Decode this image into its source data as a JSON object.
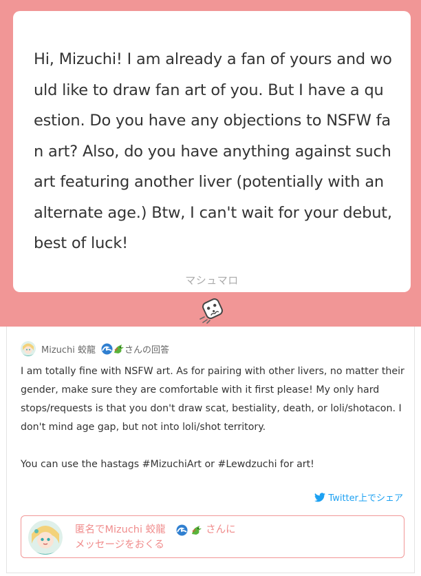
{
  "question": {
    "text": "Hi, Mizuchi!  I am already a fan of yours and would like to draw fan art of you. But I have a question. Do you have any objections to NSFW fan art? Also, do you have anything against such art featuring another liver  (potentially with an alternate age.) Btw, I can't wait for your debut, best of luck!",
    "service_label": "マシュマロ"
  },
  "answer": {
    "author_name": "Mizuchi 蛟龍",
    "header_suffix": "さんの回答",
    "paragraphs": [
      "I am totally fine with NSFW art. As for pairing with other livers, no matter their gender, make sure they are comfortable with it first please! My only hard stops/requests is that you don't draw scat, bestiality, death, or loli/shotacon. I don't mind age gap, but not into loli/shot territory.",
      "You can use the hastags #MizuchiArt or #Lewdzuchi for art!"
    ],
    "share_label": "Twitter上でシェア"
  },
  "send_box": {
    "line1_prefix": "匿名でMizuchi 蛟龍",
    "line1_suffix": "さんに",
    "line2": "メッセージをおくる"
  },
  "colors": {
    "accent": "#f19696",
    "text": "#333333",
    "muted": "#aaaaaa",
    "twitter": "#1da1f2",
    "send_text": "#f08c8c"
  },
  "icons": {
    "mascot": "marshmallow-mascot-icon",
    "share": "twitter-bird-icon",
    "emoji_1": "wave-emoji-icon",
    "emoji_2": "dragon-emoji-icon"
  }
}
